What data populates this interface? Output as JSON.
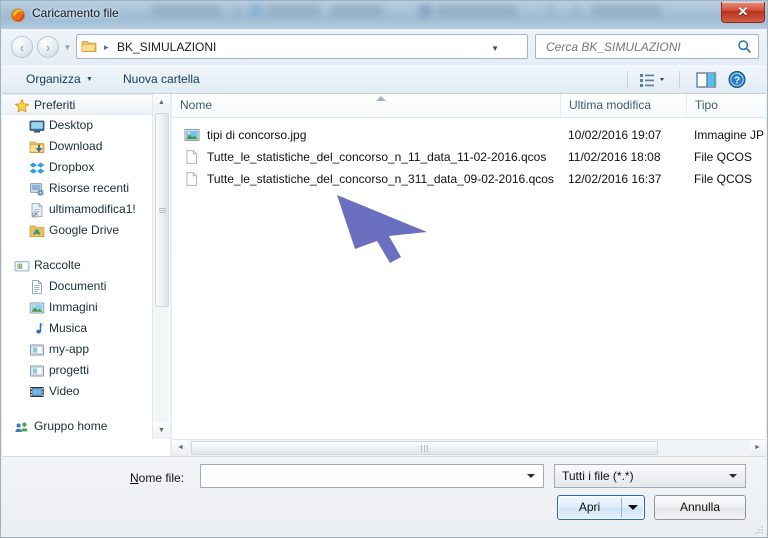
{
  "window": {
    "title": "Caricamento file",
    "title_icon": "firefox-icon",
    "close_label": "✕"
  },
  "navbar": {
    "back_icon": "back-arrow-icon",
    "forward_icon": "forward-arrow-icon",
    "history_caret": "▼",
    "address": {
      "folder_icon": "folder-icon",
      "separator": "▸",
      "path": "BK_SIMULAZIONI",
      "dropdown_caret": "▼",
      "refresh_icon": "refresh-icon"
    },
    "search": {
      "placeholder": "Cerca BK_SIMULAZIONI",
      "icon": "search-icon"
    }
  },
  "toolbar": {
    "organize_label": "Organizza",
    "organize_caret": "▼",
    "new_folder_label": "Nuova cartella",
    "view_icon": "view-list-icon",
    "view_caret": "▼",
    "preview_pane_icon": "preview-pane-icon",
    "help_icon": "help-icon"
  },
  "sidebar": {
    "groups": [
      {
        "label": "Preferiti",
        "icon": "star-icon",
        "highlighted": true,
        "items": [
          {
            "label": "Desktop",
            "icon": "desktop-icon"
          },
          {
            "label": "Download",
            "icon": "download-folder-icon"
          },
          {
            "label": "Dropbox",
            "icon": "dropbox-icon"
          },
          {
            "label": "Risorse recenti",
            "icon": "recent-places-icon"
          },
          {
            "label": "ultimamodifica1!",
            "icon": "shortcut-file-icon"
          },
          {
            "label": "Google Drive",
            "icon": "google-drive-icon"
          }
        ]
      },
      {
        "label": "Raccolte",
        "icon": "libraries-icon",
        "highlighted": false,
        "items": [
          {
            "label": "Documenti",
            "icon": "documents-icon"
          },
          {
            "label": "Immagini",
            "icon": "pictures-icon"
          },
          {
            "label": "Musica",
            "icon": "music-icon"
          },
          {
            "label": "my-app",
            "icon": "library-folder-icon"
          },
          {
            "label": "progetti",
            "icon": "library-folder-icon"
          },
          {
            "label": "Video",
            "icon": "video-icon"
          }
        ]
      },
      {
        "label": "Gruppo home",
        "icon": "homegroup-icon",
        "highlighted": false,
        "items": []
      }
    ],
    "scrollbar": {
      "up": "▲",
      "down": "▼"
    }
  },
  "filelist": {
    "columns": [
      "Nome",
      "Ultima modifica",
      "Tipo"
    ],
    "sort_column": "Nome",
    "sort_direction": "asc",
    "rows": [
      {
        "name": "tipi di concorso.jpg",
        "modified": "10/02/2016 19:07",
        "type": "Immagine JP",
        "icon": "image-file-icon"
      },
      {
        "name": "Tutte_le_statistiche_del_concorso_n_11_data_11-02-2016.qcos",
        "modified": "11/02/2016 18:08",
        "type": "File QCOS",
        "icon": "generic-file-icon"
      },
      {
        "name": "Tutte_le_statistiche_del_concorso_n_311_data_09-02-2016.qcos",
        "modified": "12/02/2016 16:37",
        "type": "File QCOS",
        "icon": "generic-file-icon"
      }
    ],
    "hscroll": {
      "left": "◄",
      "right": "►"
    }
  },
  "bottom": {
    "filename_label_prefix": "N",
    "filename_label_rest": "ome file:",
    "filename_value": "",
    "filename_caret": "▼",
    "filter_value": "Tutti i file (*.*)",
    "filter_caret": "▼",
    "open_label": "Apri",
    "open_caret": "▼",
    "cancel_label": "Annulla"
  },
  "cursor": {
    "icon": "mouse-pointer-icon",
    "color": "#6b6fc0"
  },
  "colors": {
    "accent_blue": "#2c6ca8",
    "close_red": "#c33a22",
    "titlebar_glass": "#a8c3d8",
    "cursor_purple": "#6b6fc0"
  }
}
